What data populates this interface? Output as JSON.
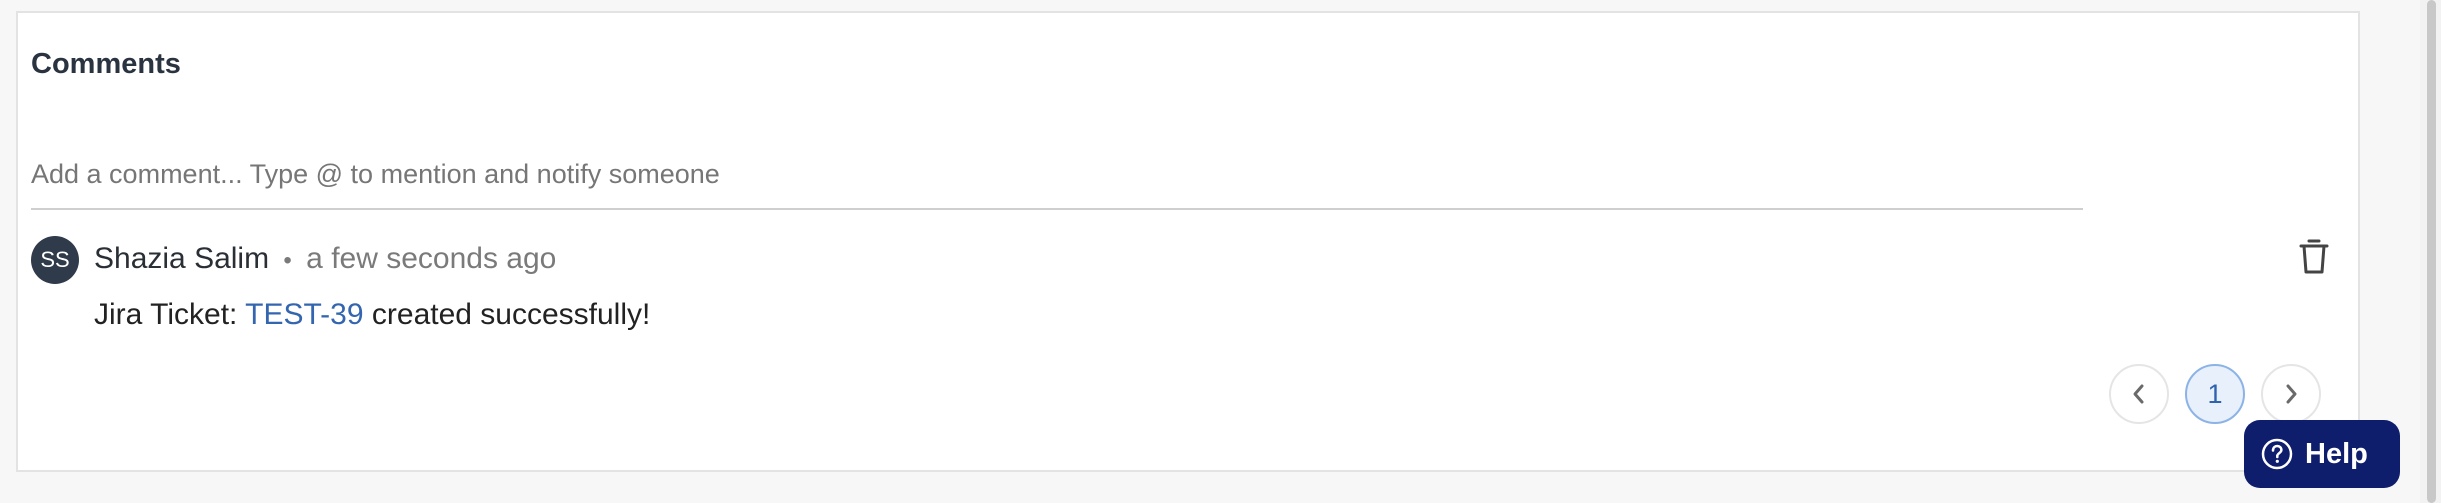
{
  "comments": {
    "title": "Comments",
    "input_placeholder": "Add a comment... Type @ to mention and notify someone",
    "items": [
      {
        "avatar_initials": "SS",
        "author": "Shazia Salim",
        "separator": "•",
        "timestamp": "a few seconds ago",
        "body_prefix": "Jira Ticket:",
        "ticket_link": "TEST-39",
        "body_suffix": "created successfully!"
      }
    ]
  },
  "pagination": {
    "current_page": "1"
  },
  "help": {
    "label": "Help"
  },
  "colors": {
    "link": "#3466b0",
    "help_button_bg": "#0f1d6d",
    "avatar_bg": "#2f3a4b",
    "page_active_bg": "#e7f0fb"
  },
  "icons": {
    "delete": "trash-icon",
    "prev": "chevron-left-icon",
    "next": "chevron-right-icon",
    "help": "question-circle-icon"
  }
}
